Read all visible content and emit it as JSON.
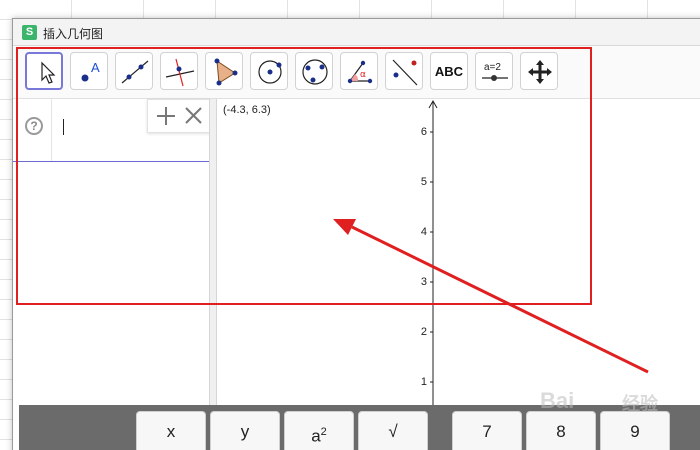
{
  "window": {
    "app_icon_letter": "S",
    "title": "插入几何图"
  },
  "toolbar": {
    "tools": [
      {
        "icon": "move-arrow-icon"
      },
      {
        "icon": "point-icon",
        "label": "A"
      },
      {
        "icon": "line-icon"
      },
      {
        "icon": "perpendicular-line-icon"
      },
      {
        "icon": "polygon-icon"
      },
      {
        "icon": "circle-center-point-icon"
      },
      {
        "icon": "circle-three-points-icon"
      },
      {
        "icon": "angle-icon",
        "label": "α"
      },
      {
        "icon": "reflect-icon"
      },
      {
        "icon": "text-tool-icon",
        "label": "ABC"
      },
      {
        "icon": "slider-icon",
        "label": "a=2"
      },
      {
        "icon": "move-graphics-view-icon"
      }
    ]
  },
  "algebra": {
    "help_icon": "?"
  },
  "graphics": {
    "coordinates_readout": "(-4.3, 6.3)",
    "y_ticks": [
      "6",
      "5",
      "4",
      "3",
      "2",
      "1"
    ]
  },
  "keyboard": {
    "keys": [
      "x",
      "y",
      "a",
      "√",
      "7",
      "8",
      "9"
    ],
    "superscript": "2"
  },
  "watermark": {
    "brand": "Bai",
    "sub": "经验"
  },
  "colors": {
    "annotation_red": "#e02020",
    "selected_tool": "#7878d8",
    "keyboard_bg": "#6b6b6b"
  }
}
